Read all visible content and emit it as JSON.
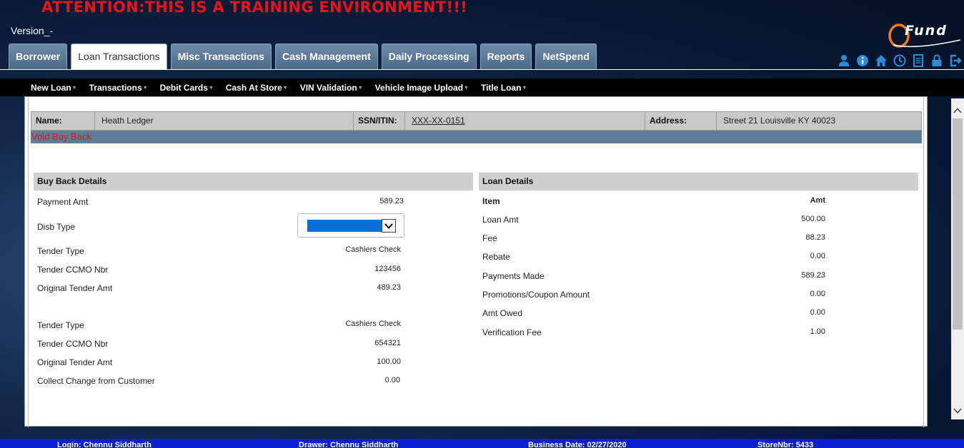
{
  "banner": {
    "attention": "ATTENTION:THIS IS A TRAINING ENVIRONMENT!!!",
    "version": "Version_-"
  },
  "logo": {
    "text": "Fund"
  },
  "tabs": [
    {
      "label": "Borrower",
      "active": false
    },
    {
      "label": "Loan Transactions",
      "active": true
    },
    {
      "label": "Misc Transactions",
      "active": false
    },
    {
      "label": "Cash Management",
      "active": false
    },
    {
      "label": "Daily Processing",
      "active": false
    },
    {
      "label": "Reports",
      "active": false
    },
    {
      "label": "NetSpend",
      "active": false
    }
  ],
  "toolbar_icons": [
    "user-icon",
    "info-icon",
    "home-icon",
    "clock-icon",
    "document-icon",
    "lock-icon",
    "logout-icon"
  ],
  "subnav": [
    {
      "label": "New Loan",
      "dropdown": true
    },
    {
      "label": "Transactions",
      "dropdown": true
    },
    {
      "label": "Debit Cards",
      "dropdown": true
    },
    {
      "label": "Cash At Store",
      "dropdown": true
    },
    {
      "label": "VIN Validation",
      "dropdown": true
    },
    {
      "label": "Vehicle Image Upload",
      "dropdown": true
    },
    {
      "label": "Title Loan",
      "dropdown": true
    }
  ],
  "customer": {
    "name_label": "Name:",
    "name": "Heath Ledger",
    "ssn_label": "SSN/ITIN:",
    "ssn": "XXX-XX-0151",
    "address_label": "Address:",
    "address": "Street 21  Louisville  KY  40023"
  },
  "void_title": "Void Buy Back",
  "buy_back": {
    "header": "Buy Back Details",
    "payment_amt_label": "Payment Amt",
    "payment_amt": "589.23",
    "disb_type_label": "Disb Type",
    "disb_type_value": "",
    "tender1": {
      "type_label": "Tender Type",
      "type": "Cashiers Check",
      "ccmo_label": "Tender CCMO Nbr",
      "ccmo": "123456",
      "orig_label": "Original Tender Amt",
      "orig": "489.23"
    },
    "tender2": {
      "type_label": "Tender Type",
      "type": "Cashiers Check",
      "ccmo_label": "Tender CCMO Nbr",
      "ccmo": "654321",
      "orig_label": "Original Tender Amt",
      "orig": "100.00"
    },
    "collect_change_label": "Collect Change from Customer",
    "collect_change": "0.00"
  },
  "loan_details": {
    "header": "Loan Details",
    "col_item": "Item",
    "col_amt": "Amt",
    "rows": [
      {
        "item": "Loan Amt",
        "amt": "500.00"
      },
      {
        "item": "Fee",
        "amt": "88.23"
      },
      {
        "item": "Rebate",
        "amt": "0.00"
      },
      {
        "item": "Payments Made",
        "amt": "589.23"
      },
      {
        "item": "Promotions/Coupon Amount",
        "amt": "0.00"
      },
      {
        "item": "Amt Owed",
        "amt": "0.00"
      },
      {
        "item": "Verification Fee",
        "amt": "1.00"
      }
    ]
  },
  "footer": {
    "login": "Login: Chennu Siddharth",
    "drawer": "Drawer: Chennu Siddharth",
    "business_date": "Business Date: 02/27/2020",
    "store": "StoreNbr: 5433"
  },
  "colors": {
    "attention": "#e8141b",
    "tab": "#5a7896",
    "footer": "#0c1fcf",
    "select_fill": "#0a6fd6"
  }
}
